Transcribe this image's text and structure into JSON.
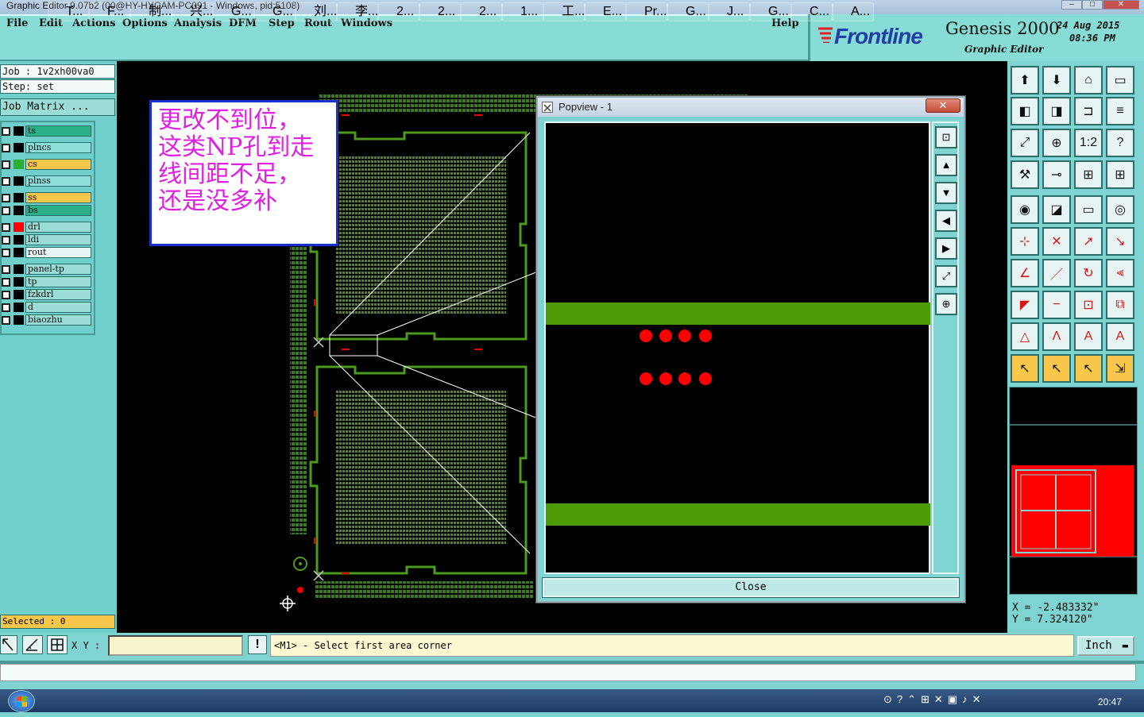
{
  "window": {
    "title": "Graphic Editor 9.07b2 (00@HY-HYCAM-PC091 - Windows, pid:5108)"
  },
  "menu": {
    "items": [
      "File",
      "Edit",
      "Actions",
      "Options",
      "Analysis",
      "DFM",
      "Step",
      "Rout",
      "Windows"
    ],
    "help": "Help"
  },
  "brand": {
    "logo": "Frontline",
    "product": "Genesis 2000",
    "subtitle": "Graphic Editor",
    "date": "24 Aug 2015",
    "time": "08:36 PM"
  },
  "job": {
    "job_label": "Job : 1v2xh00va0",
    "step_label": "Step: set",
    "matrix_button": "Job Matrix ..."
  },
  "layers": [
    {
      "name": "ts",
      "color": "#2bb08a"
    },
    {
      "name": "plncs",
      "color": "#8fe0da"
    },
    {
      "name": "cs",
      "color": "#f7c64a"
    },
    {
      "name": "plnss",
      "color": "#8fe0da"
    },
    {
      "name": "ss",
      "color": "#f7c64a"
    },
    {
      "name": "bs",
      "color": "#2bb08a"
    },
    {
      "name": "drl",
      "color": "#9adcd6"
    },
    {
      "name": "ldi",
      "color": "#9adcd6"
    },
    {
      "name": "rout",
      "color": "#e8f4f4"
    },
    {
      "name": "panel-tp",
      "color": "#9adcd6"
    },
    {
      "name": "tp",
      "color": "#9adcd6"
    },
    {
      "name": "fzkdrl",
      "color": "#9adcd6"
    },
    {
      "name": "d",
      "color": "#9adcd6"
    },
    {
      "name": "biaozhu",
      "color": "#9adcd6"
    }
  ],
  "selected_text": "Selected : 0",
  "annotation": {
    "lines": [
      "更改不到位，",
      "这类NP孔到走",
      "线间距不足，",
      "还是没多补"
    ]
  },
  "popview": {
    "title": "Popview - 1",
    "close_label": "Close"
  },
  "coords": {
    "x": "X  =  -2.483332\"",
    "y": "Y  =  7.324120\""
  },
  "status": {
    "xy_label": "X Y :",
    "xy_value": "",
    "prompt": "<M1> - Select first area corner",
    "units": "Inch"
  },
  "taskbar": {
    "items": [
      "T...",
      "F...",
      "制...",
      "兴...",
      "G...",
      "G...",
      "刘...",
      "李...",
      "2...",
      "2...",
      "2...",
      "1...",
      "工...",
      "E...",
      "Pr...",
      "G...",
      "J...",
      "G...",
      "C...",
      "A..."
    ],
    "clock": "20:47"
  }
}
